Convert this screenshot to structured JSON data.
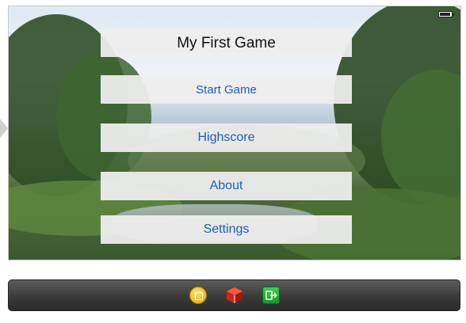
{
  "game": {
    "title": "My First Game",
    "menu": [
      {
        "id": "start",
        "label": "Start Game"
      },
      {
        "id": "highscore",
        "label": "Highscore"
      },
      {
        "id": "about",
        "label": "About"
      },
      {
        "id": "settings",
        "label": "Settings"
      }
    ]
  },
  "toolbar": {
    "icons": [
      "view-controller-icon",
      "first-responder-cube-icon",
      "exit-icon"
    ]
  },
  "colors": {
    "menu_text": "#1a5fbf",
    "title_text": "#111111",
    "toolbar_bg": "#3d3d3d"
  }
}
